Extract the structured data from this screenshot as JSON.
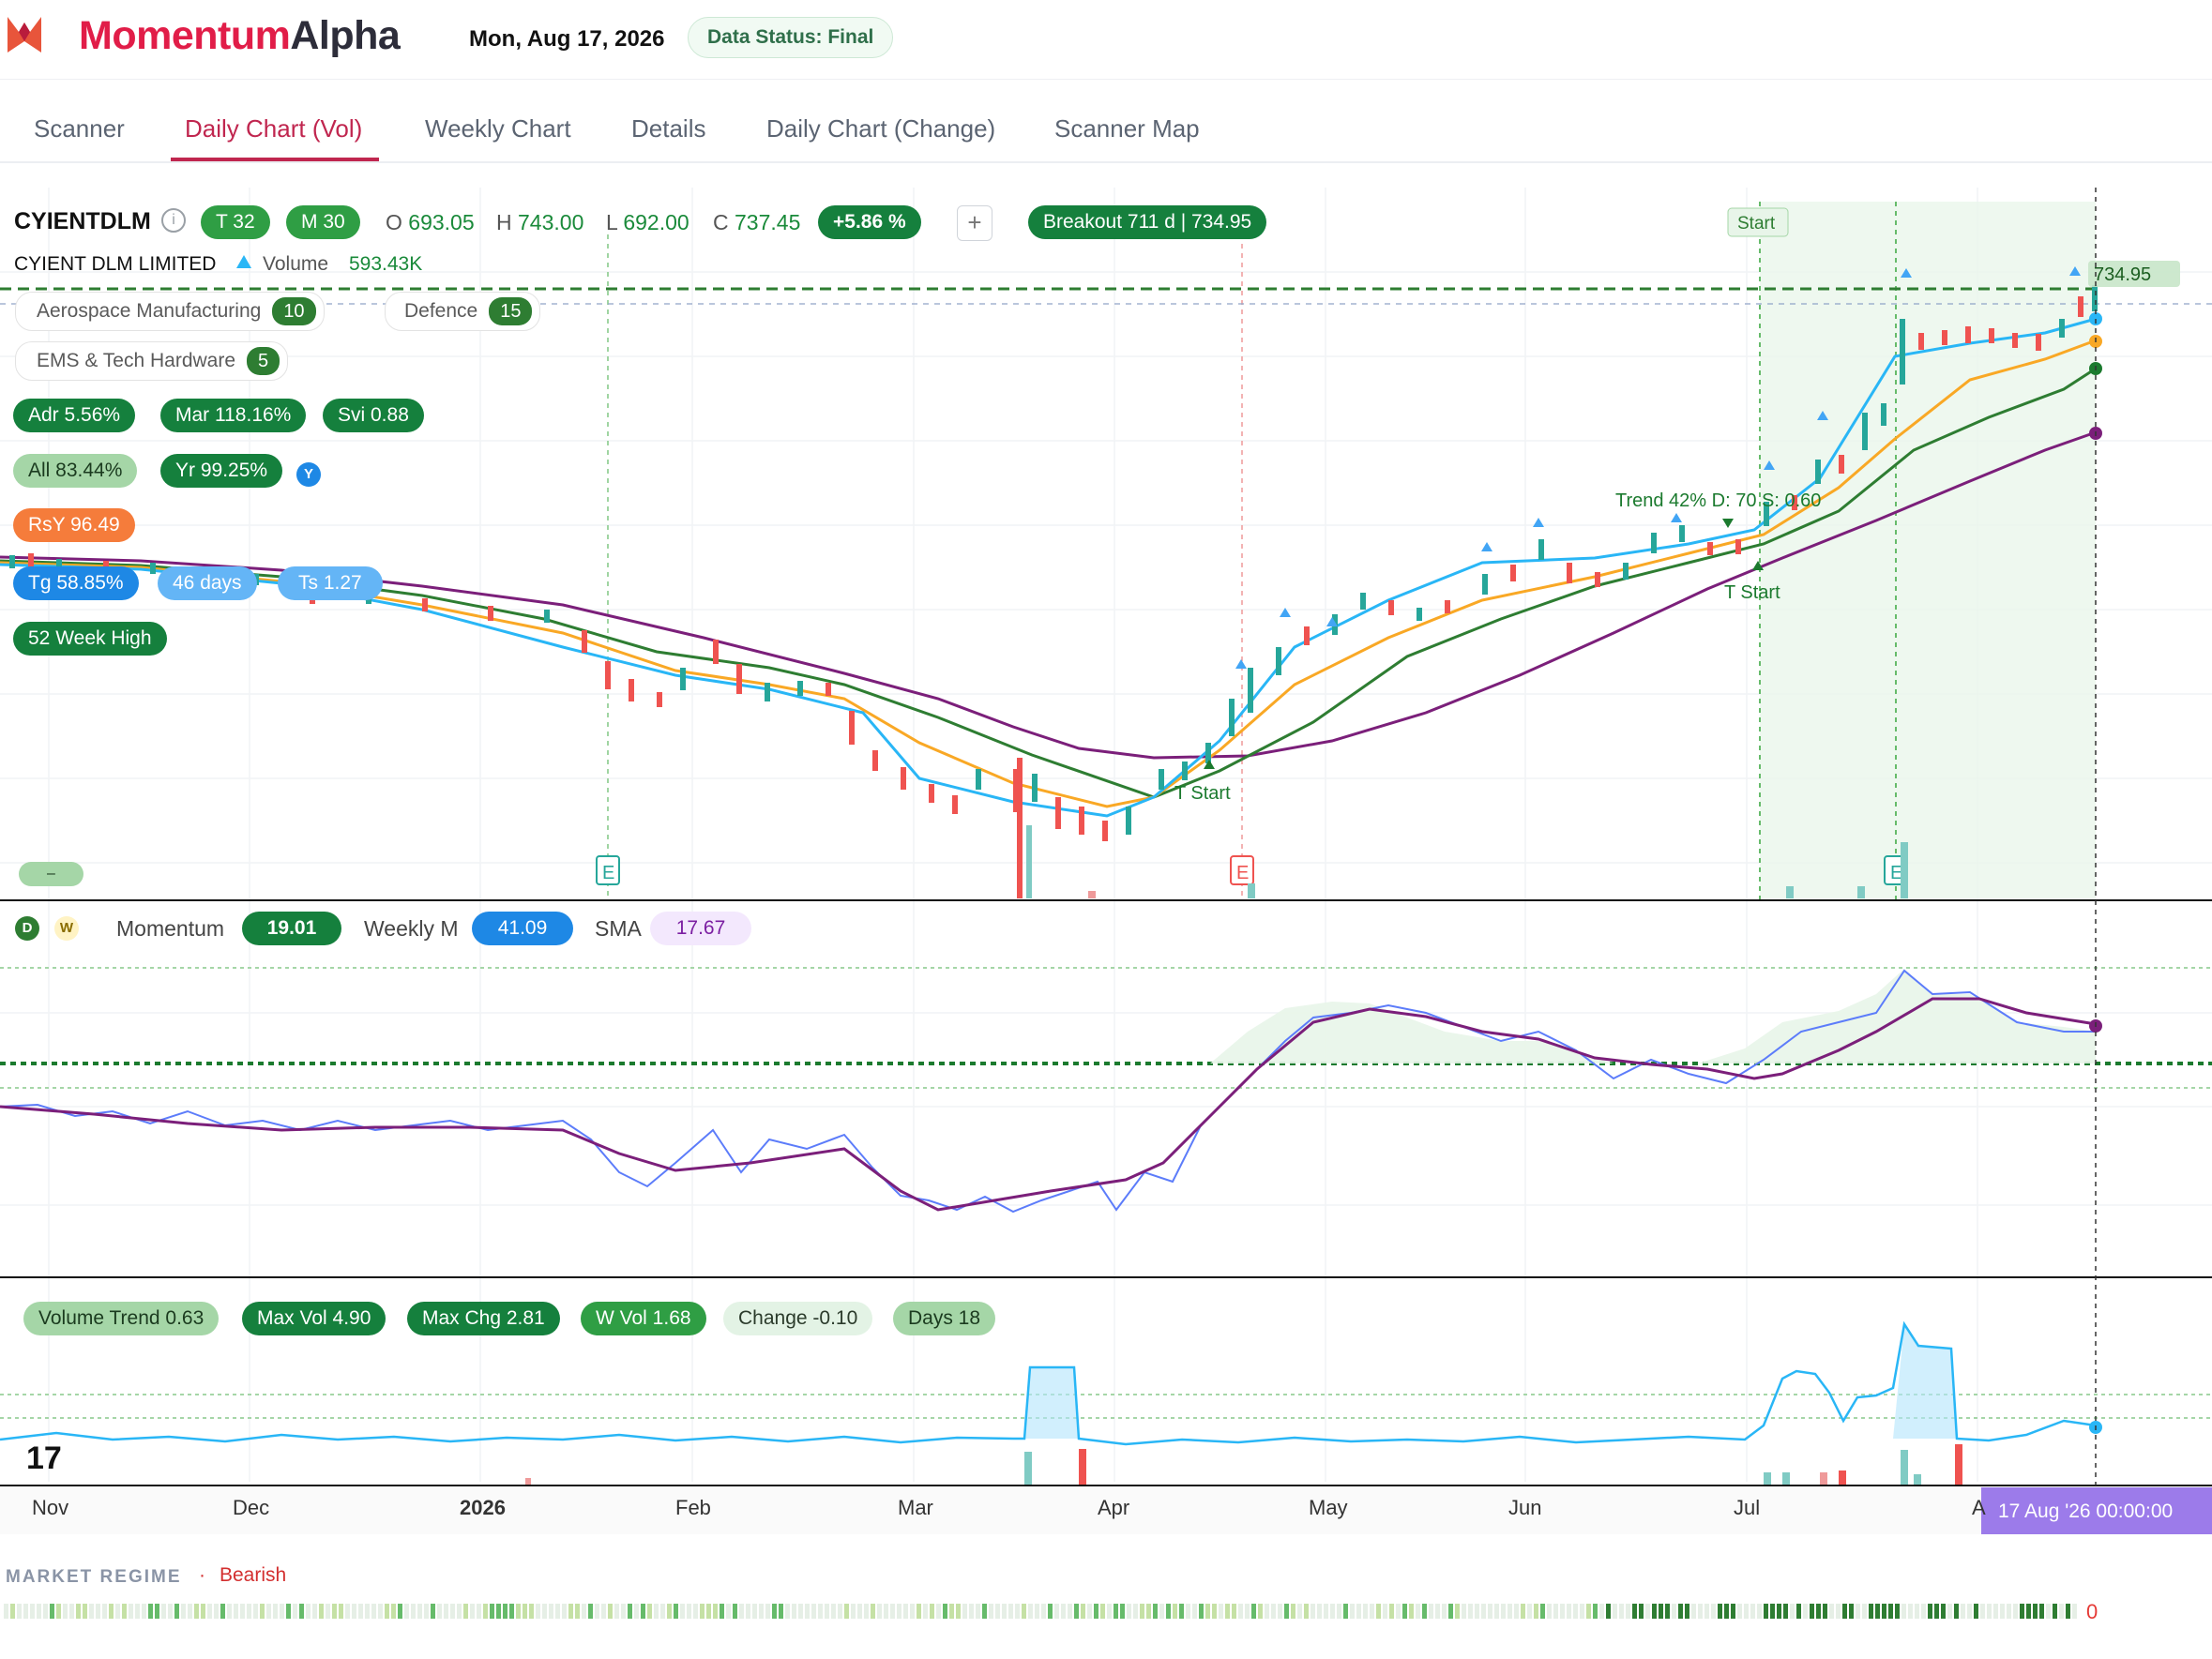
{
  "app": {
    "brand_part1": "Momentum",
    "brand_part2": "Alpha",
    "date": "Mon, Aug 17, 2026",
    "data_status": "Data Status: Final"
  },
  "tabs": [
    {
      "label": "Scanner"
    },
    {
      "label": "Daily Chart (Vol)"
    },
    {
      "label": "Weekly Chart"
    },
    {
      "label": "Details"
    },
    {
      "label": "Daily Chart (Change)"
    },
    {
      "label": "Scanner Map"
    }
  ],
  "active_tab": "Daily Chart (Vol)",
  "ticker": {
    "symbol": "CYIENTDLM",
    "name": "CYIENT DLM LIMITED",
    "t_label": "T 32",
    "m_label": "M 30",
    "open_label": "O",
    "open": "693.05",
    "high_label": "H",
    "high": "743.00",
    "low_label": "L",
    "low": "692.00",
    "close_label": "C",
    "close": "737.45",
    "change_pct": "+5.86 %",
    "breakout": "Breakout  711 d | 734.95",
    "volume_label": "Volume",
    "volume": "593.43K",
    "price_tag": "734.95"
  },
  "sectors": [
    {
      "label": "Aerospace Manufacturing",
      "count": "10"
    },
    {
      "label": "Defence",
      "count": "15"
    },
    {
      "label": "EMS & Tech Hardware",
      "count": "5"
    }
  ],
  "metrics": {
    "adr": "Adr  5.56%",
    "mar": "Mar  118.16%",
    "svi": "Svi  0.88",
    "all": "All  83.44%",
    "yr": "Yr  99.25%",
    "y_badge": "Y",
    "rsy": "RsY  96.49",
    "tg": "Tg  58.85%",
    "days": "46 days",
    "ts": "Ts  1.27",
    "week_high": "52 Week High",
    "dash_chip": "–"
  },
  "annotations": {
    "start_top": "Start",
    "trend_text": "Trend 42% D: 70 S: 0.60",
    "t_start": "T Start",
    "earnings": "E"
  },
  "momentum_panel": {
    "d_badge": "D",
    "w_badge": "W",
    "momentum_label": "Momentum",
    "momentum_value": "19.01",
    "weekly_label": "Weekly M",
    "weekly_value": "41.09",
    "sma_label": "SMA",
    "sma_value": "17.67"
  },
  "volume_panel": {
    "volume_trend": "Volume Trend  0.63",
    "max_vol": "Max Vol  4.90",
    "max_chg": "Max Chg  2.81",
    "w_vol": "W Vol  1.68",
    "change": "Change  -0.10",
    "days": "Days  18"
  },
  "x_axis": [
    "Nov",
    "Dec",
    "2026",
    "Feb",
    "Mar",
    "Apr",
    "May",
    "Jun",
    "Jul",
    "A"
  ],
  "crosshair_label": "17 Aug '26   00:00:00",
  "market_regime": {
    "label": "MARKET REGIME",
    "sep": "·",
    "value": "Bearish",
    "end_marker": "0"
  },
  "colors": {
    "up": "#26a69a",
    "down": "#ef5350",
    "ema_fast": "#29b6f6",
    "ema_mid": "#f9a825",
    "ema_slow": "#2e7d32",
    "ema_long": "#7b1f7a",
    "brand": "#e11d48"
  },
  "chart_data": {
    "type": "line",
    "x": [
      "Nov",
      "Dec",
      "2026",
      "Feb",
      "Mar",
      "Apr",
      "May",
      "Jun",
      "Jul",
      "Aug"
    ],
    "series": [
      {
        "values": [
          520,
          505,
          488,
          462,
          410,
          405,
          520,
          560,
          590,
          735
        ]
      }
    ],
    "last": 737.45
  }
}
